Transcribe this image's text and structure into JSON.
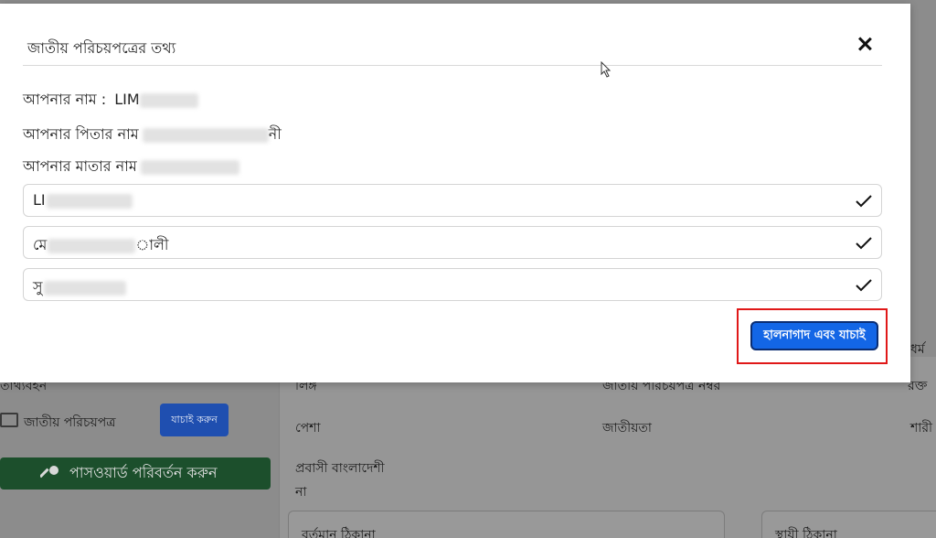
{
  "background": {
    "left_partial_heading": "তাথ্যবহন",
    "id_card_label": "জাতীয় পরিচয়পত্র",
    "verify_button": "যাচাই করুন",
    "password_button": "পাসওয়ার্ড পরিবর্তন করুন",
    "col1_label1": "লিঙ্গ",
    "col2_label1": "জাতীয় পরিচয়পত্র নম্বর",
    "col3_label1": "রক্ত",
    "col3_label0": "ধর্ম",
    "col1_label2": "পেশা",
    "col2_label2": "জাতীয়তা",
    "col3_label2": "শারী",
    "expat_label": "প্রবাসী বাংলাদেশী",
    "expat_value": "না",
    "present_address": "বর্তমান ঠিকানা",
    "permanent_address": "স্থায়ী ঠিকানা"
  },
  "modal": {
    "title": "জাতীয় পরিচয়পত্রের তথ্য",
    "name_label": "আপনার নাম :",
    "name_value_visible": "LIM",
    "father_label": "আপনার পিতার নাম",
    "father_value_visible": "নী",
    "mother_label": "আপনার মাতার নাম",
    "fields": [
      {
        "value_visible_start": "LI",
        "value_visible_end": ""
      },
      {
        "value_visible_start": "মে",
        "value_visible_end": "ালী"
      },
      {
        "value_visible_start": "সু",
        "value_visible_end": ""
      }
    ],
    "submit_button": "হালনাগাদ এবং যাচাই"
  },
  "colors": {
    "submit_bg": "#1366e6",
    "highlight": "#e01818",
    "password_btn_bg": "#1c4f2c"
  }
}
